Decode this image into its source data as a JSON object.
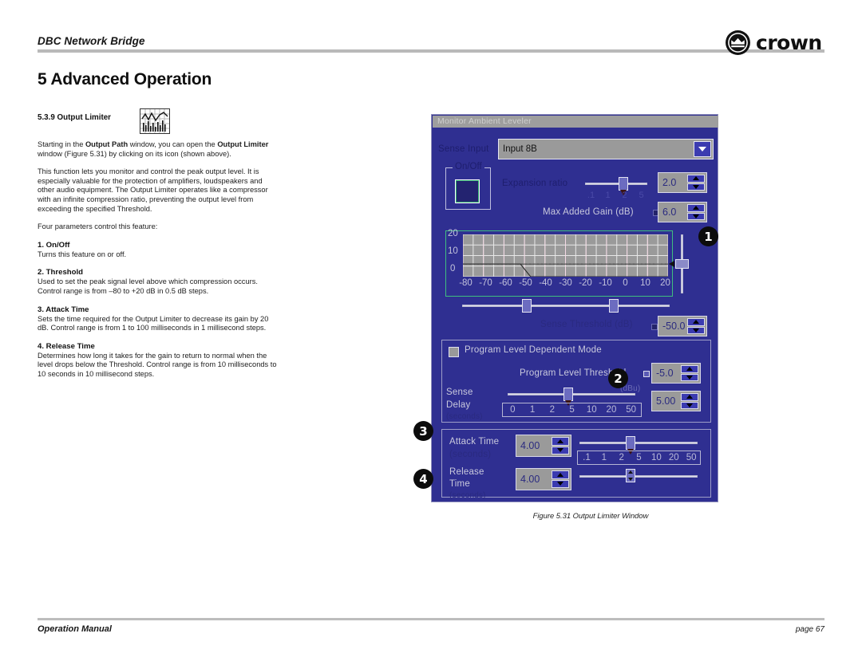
{
  "header": {
    "running_head": "DBC Network Bridge",
    "chapter_title": "5 Advanced Operation",
    "logo_word": "crown",
    "logo_icon": "crown-emblem-icon"
  },
  "section": {
    "number_and_title": "5.3.9 Output Limiter",
    "icon_name": "output-limiter-icon",
    "paragraphs": [
      "Starting in the <b>Output Path</b> window, you can open the <b>Output Limiter</b> window (Figure 5.31) by clicking on its icon (shown above).",
      "This function lets you monitor and control the peak output level. It is especially valuable for the protection of amplifiers, loudspeakers and other audio equipment. The Output Limiter operates like a compressor with an infinite compression ratio, preventing the output level from exceeding the specified Threshold.",
      "Four parameters control this feature:"
    ],
    "params": [
      {
        "heading": "1. On/Off",
        "body": "Turns this feature on or off."
      },
      {
        "heading": "2. Threshold",
        "body": "Used to set the peak signal level above which compression occurs. Control range is from &#8211;80 to +20 dB in 0.5 dB steps."
      },
      {
        "heading": "3. Attack Time",
        "body": "Sets the time required for the Output Limiter to decrease its gain by 20 dB. Control range is from 1 to 100 milliseconds in 1 millisecond steps."
      },
      {
        "heading": "4. Release Time",
        "body": "Determines how long it takes for the gain to return to normal when the level drops below the Threshold. Control range is from 10 milliseconds to 10 seconds in 10 millisecond steps."
      }
    ]
  },
  "figure": {
    "caption": "Figure 5.31  Output Limiter Window"
  },
  "dialog": {
    "title": "Monitor Ambient Leveler",
    "sense_input": {
      "label": "Sense Input",
      "value": "Input 8B",
      "dropdown_icon": "chevron-down-icon"
    },
    "onoff": {
      "caption": "On/Off",
      "state": "on"
    },
    "expansion_ratio": {
      "label": "Expansion ratio",
      "value": "2.0",
      "scale": [
        ".1",
        "1",
        "2",
        "5"
      ]
    },
    "max_added_gain": {
      "label": "Max Added Gain (dB)",
      "value": "6.0"
    },
    "sense_threshold": {
      "label": "Sense Threshold (dB)",
      "value": "-50.0"
    },
    "program_mode": {
      "checkbox_label": "Program Level Dependent Mode",
      "checked": false,
      "threshold_label": "Program Level Threshold",
      "threshold_value": "-5.0",
      "threshold_units": "(dBu)",
      "sense_delay_label_line1": "Sense",
      "sense_delay_label_line2": "Delay",
      "sense_delay_label_line3": "(seconds)",
      "sense_delay_value": "5.00",
      "sense_delay_scale": [
        "0",
        "1",
        "2",
        "5",
        "10",
        "20",
        "50"
      ]
    },
    "attack_time": {
      "label_line1": "Attack Time",
      "label_line2": "(seconds)",
      "value": "4.00",
      "scale": [
        ".1",
        "1",
        "2",
        "5",
        "10",
        "20",
        "50"
      ]
    },
    "release_time": {
      "label_line1": "Release",
      "label_line2": "Time",
      "label_line3": "(seconds)",
      "value": "4.00"
    },
    "callouts": [
      "1",
      "2",
      "3",
      "4"
    ]
  },
  "chart_data": {
    "type": "line",
    "title": "",
    "xlabel": "",
    "ylabel": "",
    "xlim": [
      -80,
      20
    ],
    "ylim": [
      0,
      20
    ],
    "xticks": [
      -80,
      -70,
      -60,
      -50,
      -40,
      -30,
      -20,
      -10,
      0,
      10,
      20
    ],
    "yticks": [
      0,
      10,
      20
    ],
    "grid": true,
    "series": [
      {
        "name": "transfer-curve",
        "x": [
          -80,
          -52,
          -47,
          20
        ],
        "y": [
          6,
          6,
          0,
          0
        ]
      },
      {
        "name": "threshold-line",
        "x": [
          -80,
          20
        ],
        "y": [
          6,
          6
        ]
      }
    ]
  },
  "footer": {
    "left": "Operation Manual",
    "right": "page 67"
  }
}
